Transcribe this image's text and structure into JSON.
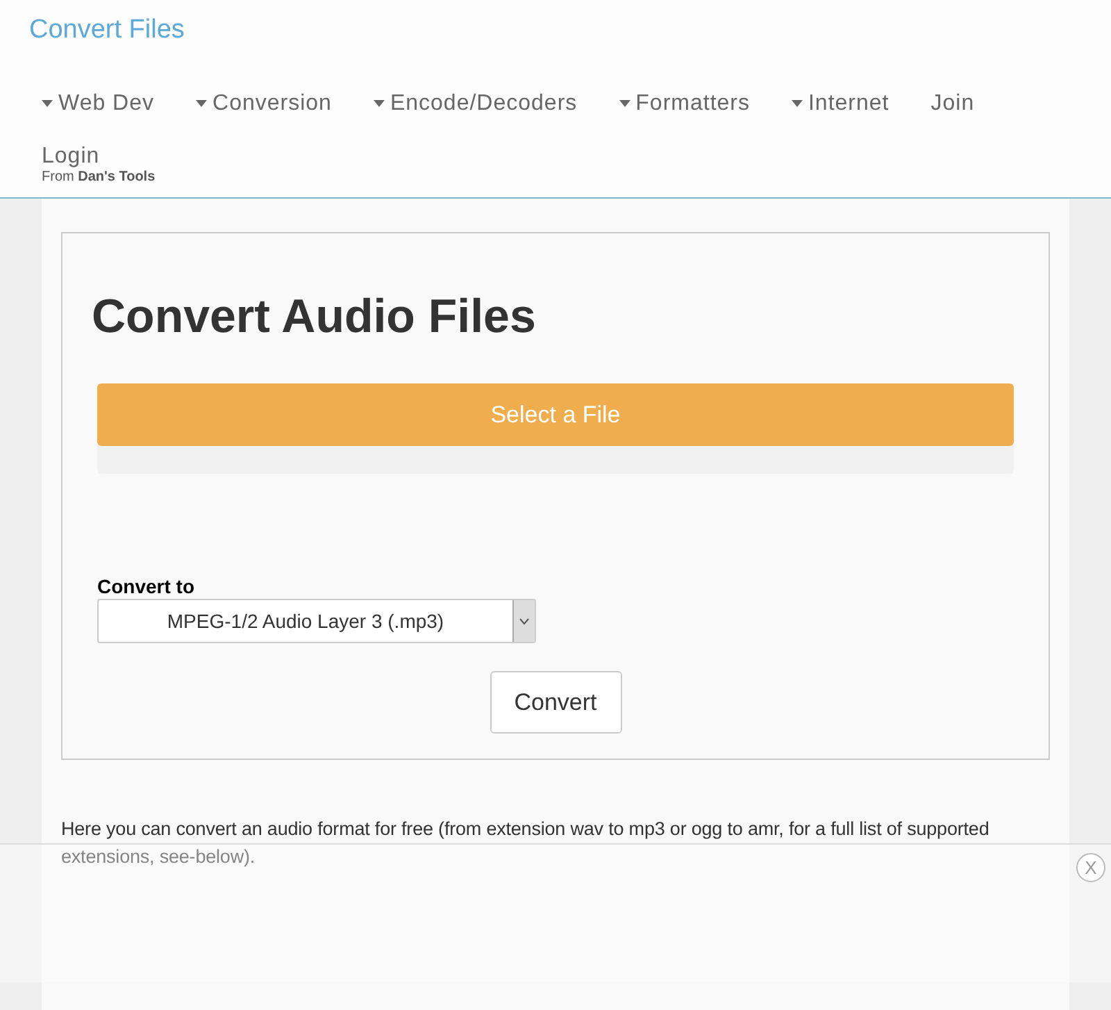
{
  "site_title": "Convert Files",
  "nav": [
    {
      "label": "Web Dev",
      "kind": "dropdown"
    },
    {
      "label": "Conversion",
      "kind": "dropdown"
    },
    {
      "label": "Encode/Decoders",
      "kind": "dropdown"
    },
    {
      "label": "Formatters",
      "kind": "dropdown"
    },
    {
      "label": "Internet",
      "kind": "dropdown"
    },
    {
      "label": "Join",
      "kind": "link"
    }
  ],
  "login": {
    "label": "Login",
    "subtitle": "From **Dan's Tools**"
  },
  "card": {
    "title": "Convert Audio Files",
    "select_button": "Select a File",
    "convert_label": "Convert to",
    "format_value": "MPEG-1/2 Audio Layer 3 (.mp3)",
    "convert_button": "Convert"
  },
  "description": "Here you can convert an audio format for free (from extension wav to mp3 or ogg to amr, for a full list of supported extensions, see-below).",
  "ad_overlay": {
    "close": "X"
  }
}
